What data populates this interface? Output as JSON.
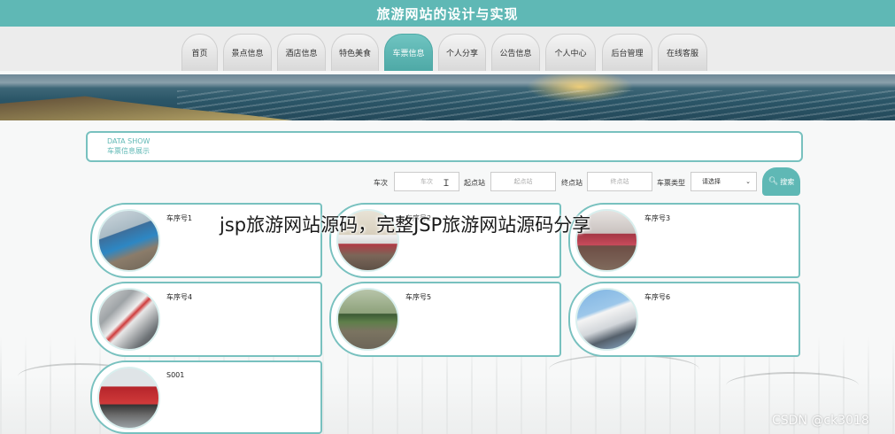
{
  "header": {
    "title": "旅游网站的设计与实现"
  },
  "nav": {
    "tabs": [
      {
        "label": "首页",
        "active": false
      },
      {
        "label": "景点信息",
        "active": false
      },
      {
        "label": "酒店信息",
        "active": false
      },
      {
        "label": "特色美食",
        "active": false
      },
      {
        "label": "车票信息",
        "active": true
      },
      {
        "label": "个人分享",
        "active": false
      },
      {
        "label": "公告信息",
        "active": false
      },
      {
        "label": "个人中心",
        "active": false
      },
      {
        "label": "后台管理",
        "active": false
      },
      {
        "label": "在线客服",
        "active": false
      }
    ]
  },
  "data_show": {
    "en": "DATA SHOW",
    "cn": "车票信息展示"
  },
  "search": {
    "train_no_label": "车次",
    "train_no_placeholder": "车次",
    "start_label": "起点站",
    "start_placeholder": "起点站",
    "end_label": "终点站",
    "end_placeholder": "终点站",
    "type_label": "车票类型",
    "type_selected": "请选择",
    "button_label": "搜索"
  },
  "cards": [
    {
      "title": "车序号1",
      "photo": "train-photo"
    },
    {
      "title": "车序号2",
      "photo": "train-photo"
    },
    {
      "title": "车序号3",
      "photo": "train-photo"
    },
    {
      "title": "车序号4",
      "photo": "train-photo"
    },
    {
      "title": "车序号5",
      "photo": "train-photo"
    },
    {
      "title": "车序号6",
      "photo": "train-photo"
    },
    {
      "title": "S001",
      "photo": "truck-photo"
    }
  ],
  "overlay": {
    "caption": "jsp旅游网站源码，完整JSP旅游网站源码分享"
  },
  "watermark": {
    "text": "CSDN @ck3018"
  },
  "colors": {
    "accent": "#5fb8b5",
    "border": "#78c1bf"
  }
}
